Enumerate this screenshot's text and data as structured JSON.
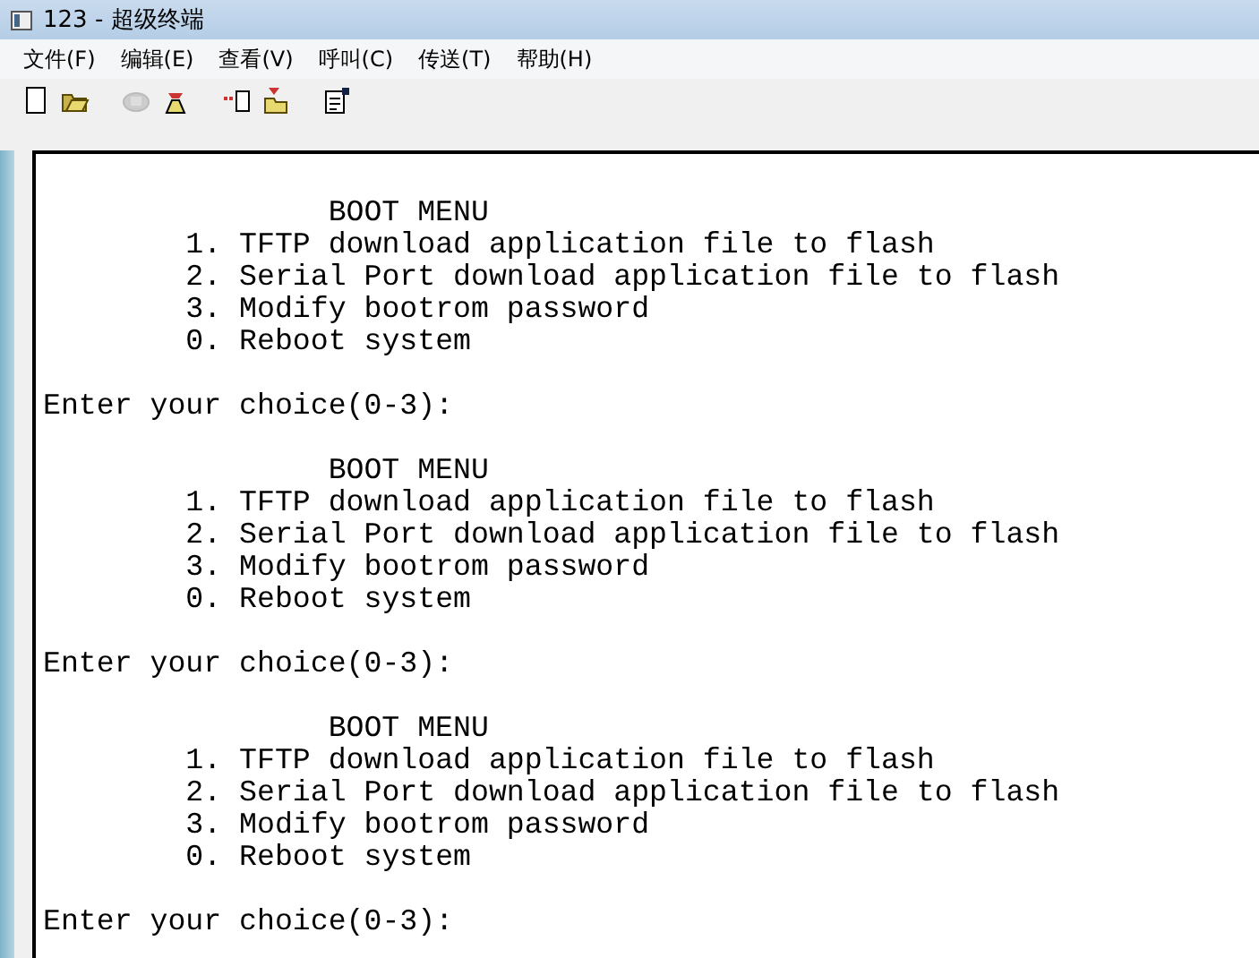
{
  "window": {
    "title": "123 - 超级终端"
  },
  "menu": [
    "文件(F)",
    "编辑(E)",
    "查看(V)",
    "呼叫(C)",
    "传送(T)",
    "帮助(H)"
  ],
  "toolbar": [
    {
      "kind": "new",
      "disabled": false
    },
    {
      "kind": "open",
      "disabled": false
    },
    {
      "kind": "call",
      "disabled": true
    },
    {
      "kind": "hangup",
      "disabled": false
    },
    {
      "kind": "send",
      "disabled": false
    },
    {
      "kind": "receive",
      "disabled": false
    },
    {
      "kind": "properties",
      "disabled": false
    }
  ],
  "terminal": {
    "blocks": [
      {
        "title": "BOOT MENU",
        "items": [
          "1. TFTP download application file to flash",
          "2. Serial Port download application file to flash",
          "3. Modify bootrom password",
          "0. Reboot system"
        ],
        "prompt": "Enter your choice(0-3):"
      },
      {
        "title": "BOOT MENU",
        "items": [
          "1. TFTP download application file to flash",
          "2. Serial Port download application file to flash",
          "3. Modify bootrom password",
          "0. Reboot system"
        ],
        "prompt": "Enter your choice(0-3):"
      },
      {
        "title": "BOOT MENU",
        "items": [
          "1. TFTP download application file to flash",
          "2. Serial Port download application file to flash",
          "3. Modify bootrom password",
          "0. Reboot system"
        ],
        "prompt": "Enter your choice(0-3):"
      }
    ]
  }
}
